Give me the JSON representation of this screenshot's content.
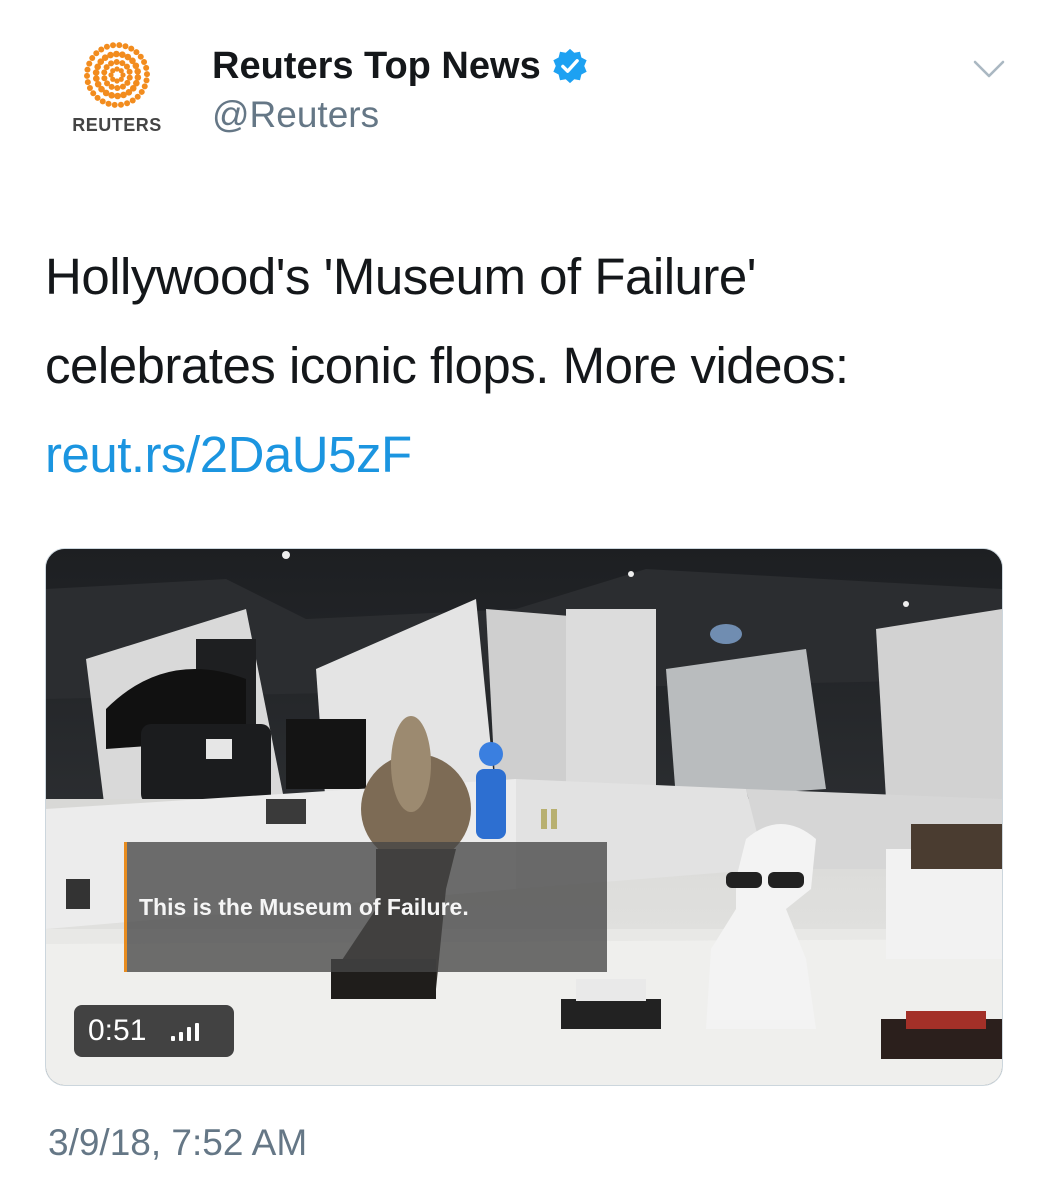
{
  "author": {
    "display_name": "Reuters Top News",
    "handle": "@Reuters",
    "avatar_wordmark": "REUTERS",
    "verified": true
  },
  "tweet": {
    "text_line1": "Hollywood's 'Museum of Failure'",
    "text_line2": "celebrates iconic flops. More videos:",
    "link": "reut.rs/2DaU5zF",
    "timestamp": "3/9/18, 7:52 AM"
  },
  "video": {
    "subtitle": "This is the Museum of Failure.",
    "duration": "0:51"
  },
  "colors": {
    "link": "#1b95e0",
    "verified_badge": "#1da1f2",
    "brand_orange": "#f28c1e",
    "muted_text": "#657786"
  },
  "icons": {
    "avatar": "reuters-logo-icon",
    "verified": "verified-badge-icon",
    "menu": "chevron-down-icon",
    "volume": "volume-bars-icon"
  }
}
